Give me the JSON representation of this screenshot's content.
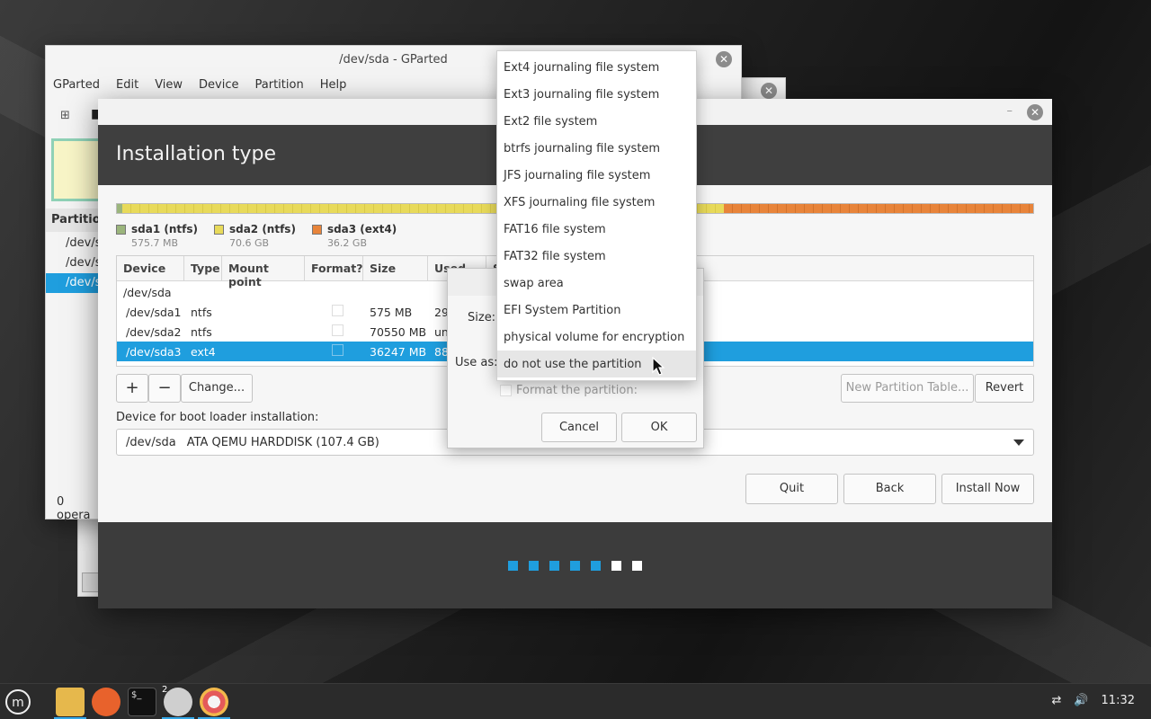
{
  "gparted": {
    "title": "/dev/sda - GParted",
    "menu": [
      "GParted",
      "Edit",
      "View",
      "Device",
      "Partition",
      "Help"
    ],
    "partition_header": "Partitio",
    "rows": [
      "/dev/s",
      "/dev/s",
      "/dev/s"
    ],
    "status": "0 opera"
  },
  "installer": {
    "title": "Installation type",
    "legend": [
      {
        "name": "sda1 (ntfs)",
        "size": "575.7 MB",
        "color": "#9bb57c"
      },
      {
        "name": "sda2 (ntfs)",
        "size": "70.6 GB",
        "color": "#e8da5a"
      },
      {
        "name": "sda3 (ext4)",
        "size": "36.2 GB",
        "color": "#e8843a"
      }
    ],
    "table": {
      "columns": [
        "Device",
        "Type",
        "Mount point",
        "Format?",
        "Size",
        "Used",
        "S"
      ],
      "rows": [
        {
          "device": "/dev/sda",
          "type": "",
          "mount": "",
          "size": "",
          "used": ""
        },
        {
          "device": "/dev/sda1",
          "type": "ntfs",
          "mount": "",
          "size": "575 MB",
          "used": "29"
        },
        {
          "device": "/dev/sda2",
          "type": "ntfs",
          "mount": "",
          "size": "70550 MB",
          "used": "un"
        },
        {
          "device": "/dev/sda3",
          "type": "ext4",
          "mount": "",
          "size": "36247 MB",
          "used": "88"
        }
      ]
    },
    "buttons": {
      "add": "+",
      "remove": "−",
      "change": "Change...",
      "new_table": "New Partition Table...",
      "revert": "Revert",
      "quit": "Quit",
      "back": "Back",
      "install": "Install Now"
    },
    "boot_label": "Device for boot loader installation:",
    "boot_device": "/dev/sda",
    "boot_desc": "ATA QEMU HARDDISK (107.4 GB)",
    "progress_step": 5,
    "progress_total": 7
  },
  "dialog": {
    "size_label": "Size:",
    "use_as_label": "Use as:",
    "format_label": "Format the partition:",
    "cancel": "Cancel",
    "ok": "OK"
  },
  "dropdown": {
    "options": [
      "Ext4 journaling file system",
      "Ext3 journaling file system",
      "Ext2 file system",
      "btrfs journaling file system",
      "JFS journaling file system",
      "XFS journaling file system",
      "FAT16 file system",
      "FAT32 file system",
      "swap area",
      "EFI System Partition",
      "physical volume for encryption",
      "do not use the partition"
    ],
    "highlighted_index": 11
  },
  "taskbar": {
    "clock": "11:32",
    "badge": "2",
    "accent": "#35a8e8"
  }
}
